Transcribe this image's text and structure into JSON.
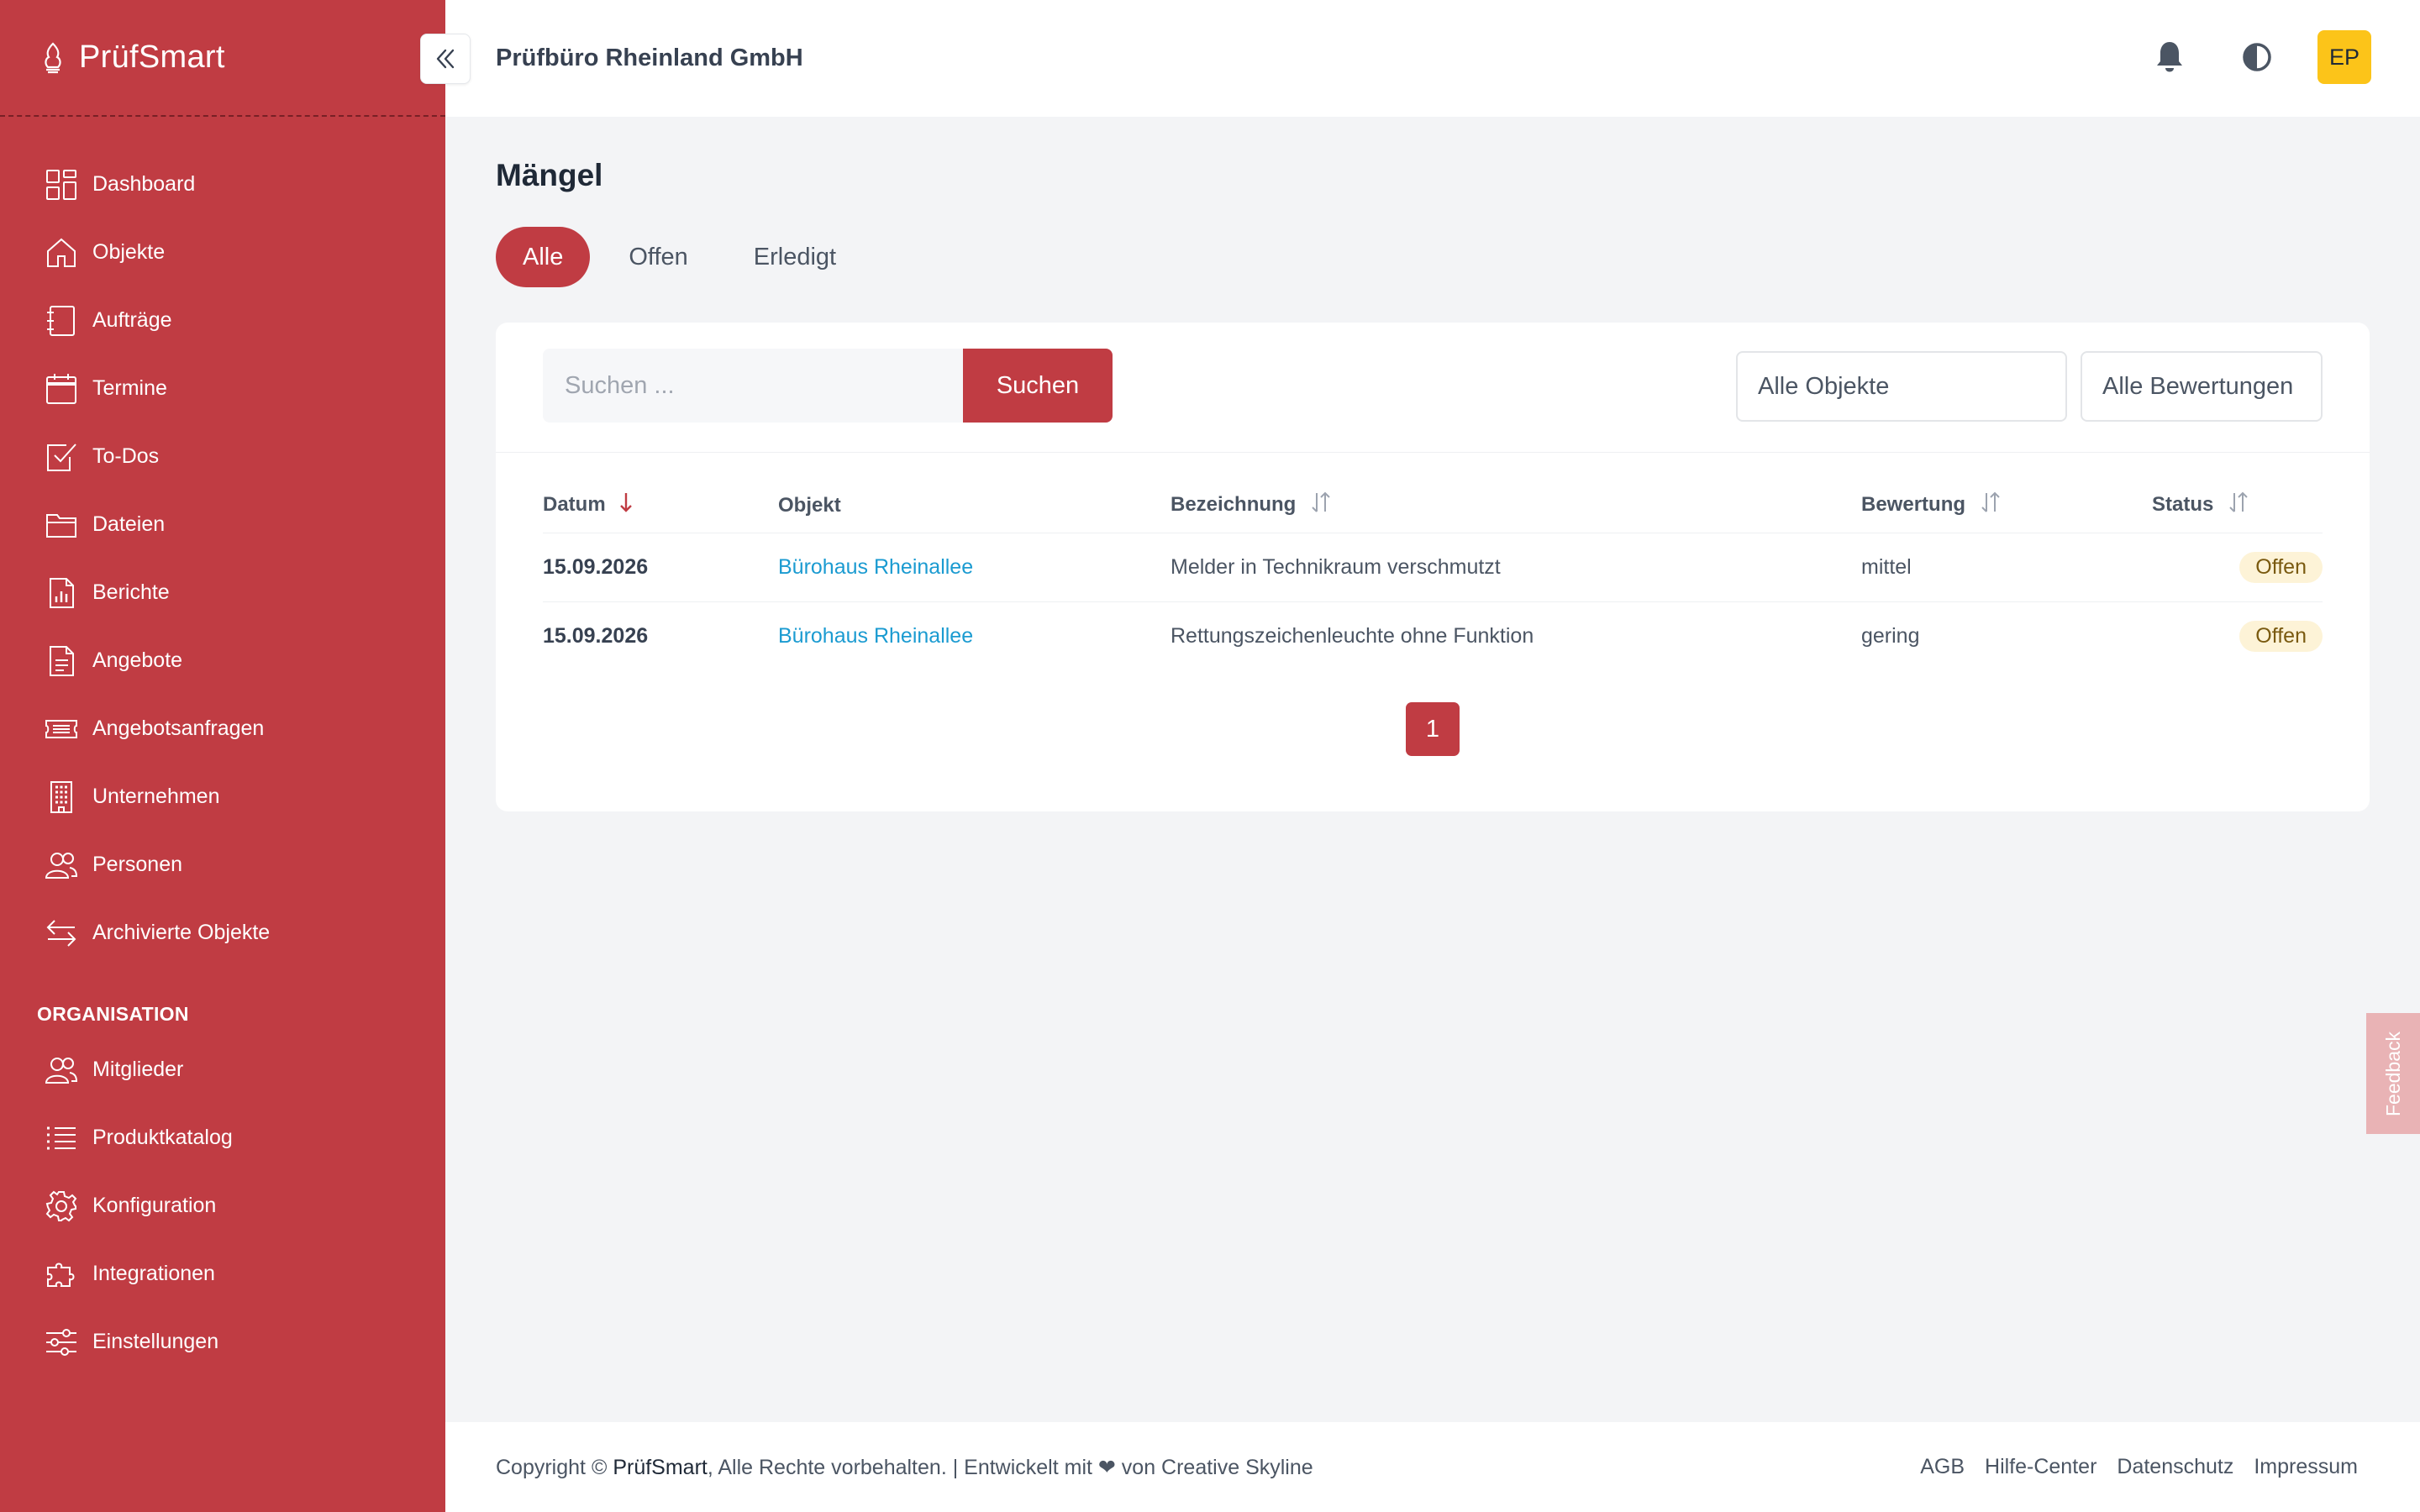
{
  "app": {
    "name": "PrüfSmart",
    "organization": "Prüfbüro Rheinland GmbH",
    "user_initials": "EP",
    "accent_color": "#c03c43"
  },
  "sidebar": {
    "items": [
      {
        "label": "Dashboard",
        "icon": "dashboard-icon"
      },
      {
        "label": "Objekte",
        "icon": "home-icon"
      },
      {
        "label": "Aufträge",
        "icon": "notebook-icon"
      },
      {
        "label": "Termine",
        "icon": "calendar-icon"
      },
      {
        "label": "To-Dos",
        "icon": "checkbox-icon"
      },
      {
        "label": "Dateien",
        "icon": "folder-icon"
      },
      {
        "label": "Berichte",
        "icon": "report-icon"
      },
      {
        "label": "Angebote",
        "icon": "document-icon"
      },
      {
        "label": "Angebotsanfragen",
        "icon": "ticket-icon"
      },
      {
        "label": "Unternehmen",
        "icon": "building-icon"
      },
      {
        "label": "Personen",
        "icon": "people-icon"
      },
      {
        "label": "Archivierte Objekte",
        "icon": "arrows-icon"
      }
    ],
    "section_title": "ORGANISATION",
    "org_items": [
      {
        "label": "Mitglieder",
        "icon": "people-icon"
      },
      {
        "label": "Produktkatalog",
        "icon": "list-icon"
      },
      {
        "label": "Konfiguration",
        "icon": "gear-icon"
      },
      {
        "label": "Integrationen",
        "icon": "puzzle-icon"
      },
      {
        "label": "Einstellungen",
        "icon": "sliders-icon"
      }
    ]
  },
  "page": {
    "title": "Mängel",
    "tabs": [
      {
        "label": "Alle",
        "active": true
      },
      {
        "label": "Offen",
        "active": false
      },
      {
        "label": "Erledigt",
        "active": false
      }
    ]
  },
  "filters": {
    "search_placeholder": "Suchen ...",
    "search_button": "Suchen",
    "objects_select": "Alle Objekte",
    "ratings_select": "Alle Bewertungen"
  },
  "table": {
    "columns": [
      "Datum",
      "Objekt",
      "Bezeichnung",
      "Bewertung",
      "Status"
    ],
    "rows": [
      {
        "date": "15.09.2026",
        "object": "Bürohaus Rheinallee",
        "description": "Melder in Technikraum verschmutzt",
        "rating": "mittel",
        "status": "Offen"
      },
      {
        "date": "15.09.2026",
        "object": "Bürohaus Rheinallee",
        "description": "Rettungszeichenleuchte ohne Funktion",
        "rating": "gering",
        "status": "Offen"
      }
    ]
  },
  "pagination": {
    "current": "1"
  },
  "footer": {
    "copyright_prefix": "Copyright ©",
    "brand": "PrüfSmart",
    "copyright_suffix": ", Alle Rechte vorbehalten. | Entwickelt mit ❤ von Creative Skyline",
    "links": [
      "AGB",
      "Hilfe-Center",
      "Datenschutz",
      "Impressum"
    ]
  },
  "feedback_label": "Feedback"
}
